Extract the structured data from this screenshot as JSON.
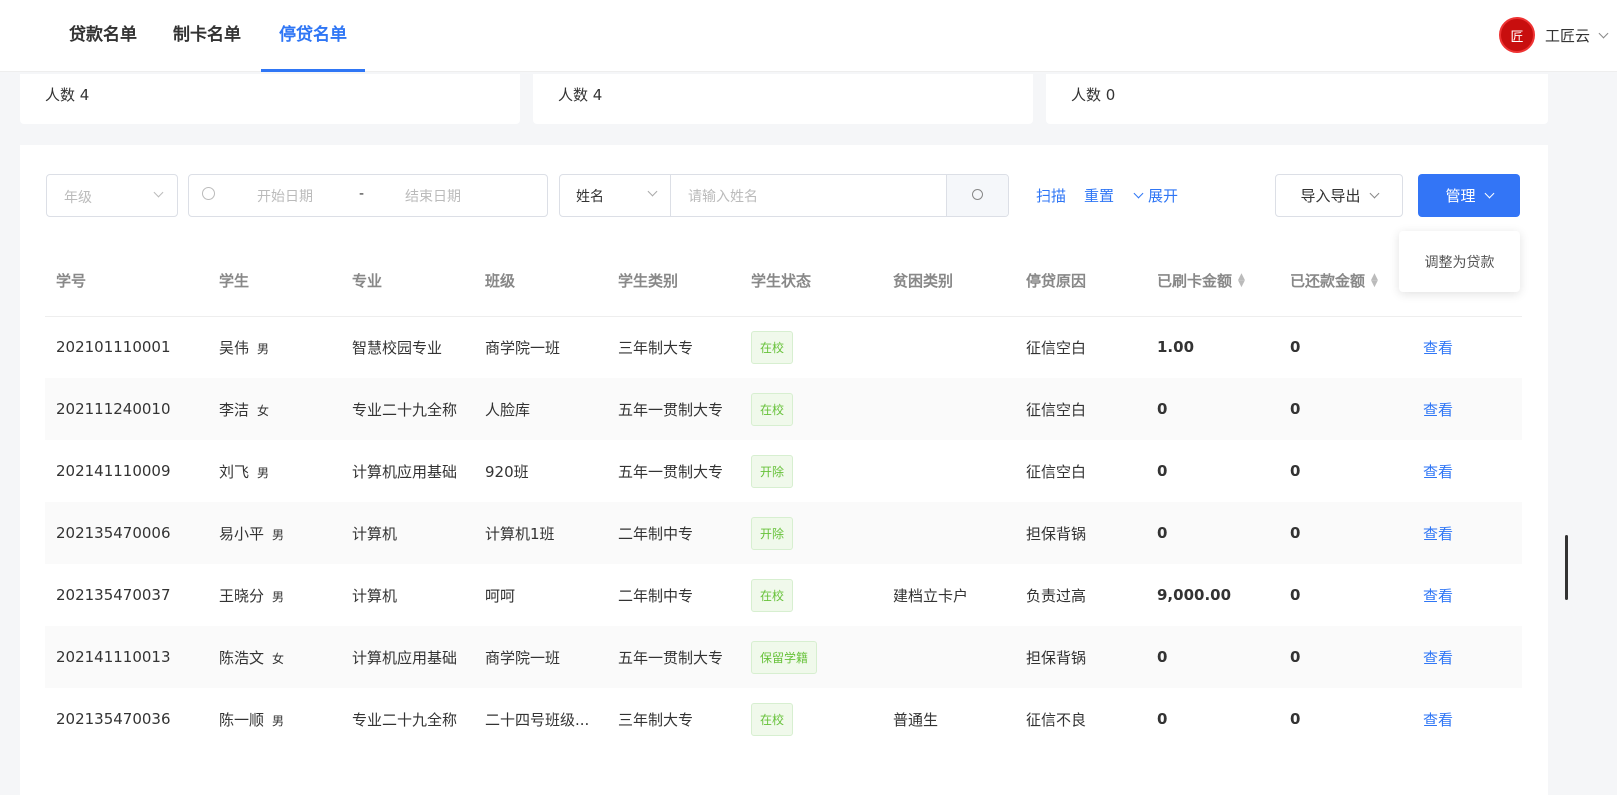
{
  "tabs": [
    "贷款名单",
    "制卡名单",
    "停贷名单"
  ],
  "user": {
    "name": "工匠云",
    "logo_text": "匠"
  },
  "cards": [
    "人数 4",
    "人数 4",
    "人数 0"
  ],
  "filters": {
    "grade_placeholder": "年级",
    "start_placeholder": "开始日期",
    "sep": "-",
    "end_placeholder": "结束日期",
    "field_select": "姓名",
    "name_placeholder": "请输入姓名",
    "scan": "扫描",
    "reset": "重置",
    "expand": "展开",
    "import_export": "导入导出",
    "manage": "管理",
    "dropdown_item": "调整为贷款"
  },
  "columns": [
    "学号",
    "学生",
    "专业",
    "班级",
    "学生类别",
    "学生状态",
    "贫困类别",
    "停贷原因",
    "已刷卡金额",
    "已还款金额",
    ""
  ],
  "rows": [
    [
      "202101110001",
      "吴伟",
      "男",
      "智慧校园专业",
      "商学院一班",
      "三年制大专",
      "在校",
      "",
      "征信空白",
      "1.00",
      "0",
      "查看"
    ],
    [
      "202111240010",
      "李洁",
      "女",
      "专业二十九全称",
      "人脸库",
      "五年一贯制大专",
      "在校",
      "",
      "征信空白",
      "0",
      "0",
      "查看"
    ],
    [
      "202141110009",
      "刘飞",
      "男",
      "计算机应用基础",
      "920班",
      "五年一贯制大专",
      "开除",
      "",
      "征信空白",
      "0",
      "0",
      "查看"
    ],
    [
      "202135470006",
      "易小平",
      "男",
      "计算机",
      "计算机1班",
      "二年制中专",
      "开除",
      "",
      "担保背锅",
      "0",
      "0",
      "查看"
    ],
    [
      "202135470037",
      "王晓分",
      "男",
      "计算机",
      "呵呵",
      "二年制中专",
      "在校",
      "建档立卡户",
      "负责过高",
      "9,000.00",
      "0",
      "查看"
    ],
    [
      "202141110013",
      "陈浩文",
      "女",
      "计算机应用基础",
      "商学院一班",
      "五年一贯制大专",
      "保留学籍",
      "",
      "担保背锅",
      "0",
      "0",
      "查看"
    ],
    [
      "202135470036",
      "陈一顺",
      "男",
      "专业二十九全称",
      "二十四号班级...",
      "三年制大专",
      "在校",
      "普通生",
      "征信不良",
      "0",
      "0",
      "查看"
    ]
  ]
}
